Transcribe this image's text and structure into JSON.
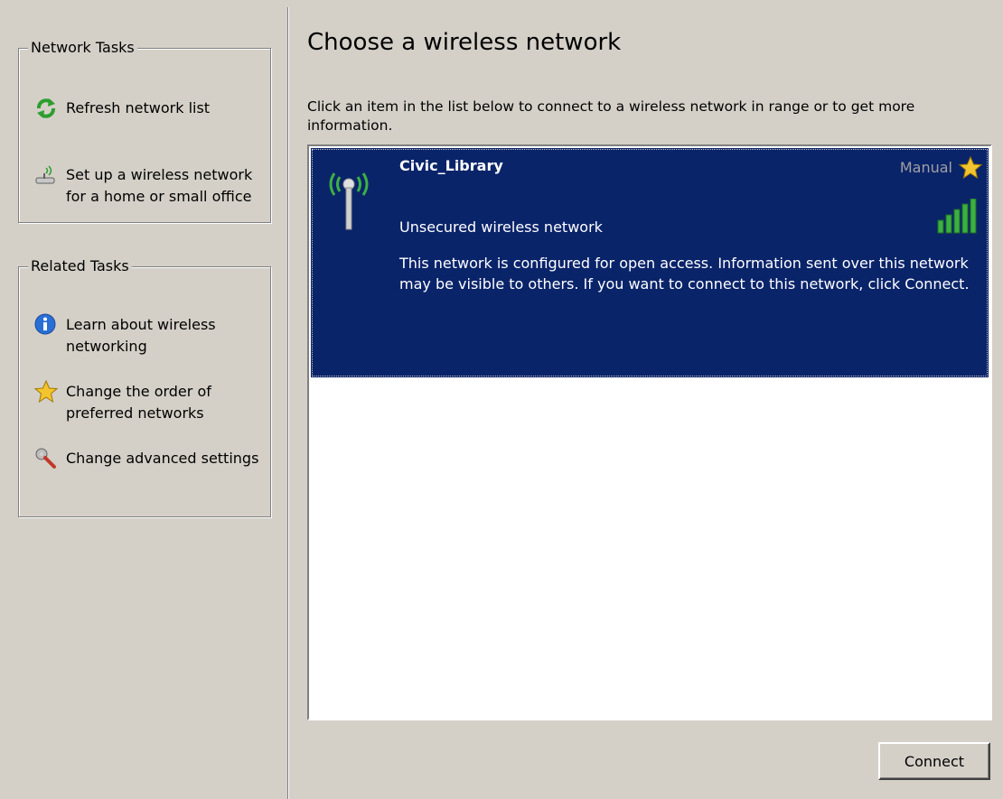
{
  "network_tasks": {
    "title": "Network Tasks",
    "items": [
      {
        "label": "Refresh network list",
        "icon": "refresh-icon"
      },
      {
        "label": "Set up a wireless network for a home or small office",
        "icon": "wireless-setup-icon"
      }
    ]
  },
  "related_tasks": {
    "title": "Related Tasks",
    "items": [
      {
        "label": "Learn about wireless networking",
        "icon": "info-icon"
      },
      {
        "label": "Change the order of preferred networks",
        "icon": "star-icon"
      },
      {
        "label": "Change advanced settings",
        "icon": "settings-icon"
      }
    ]
  },
  "main": {
    "title": "Choose a wireless network",
    "intro": "Click an item in the list below to connect to a wireless network in range or to get more information."
  },
  "networks": [
    {
      "name": "Civic_Library",
      "type": "Manual",
      "security": "Unsecured wireless network",
      "description": "This network is configured for open access. Information sent over this network may be visible to others. If you want to connect to this network, click Connect.",
      "signal_bars_total": 5,
      "signal_bars_filled": 5
    }
  ],
  "buttons": {
    "connect": "Connect"
  },
  "colors": {
    "selection": "#0a246a",
    "signal_green": "#3cb043",
    "window_bg": "#d4d0c8"
  }
}
